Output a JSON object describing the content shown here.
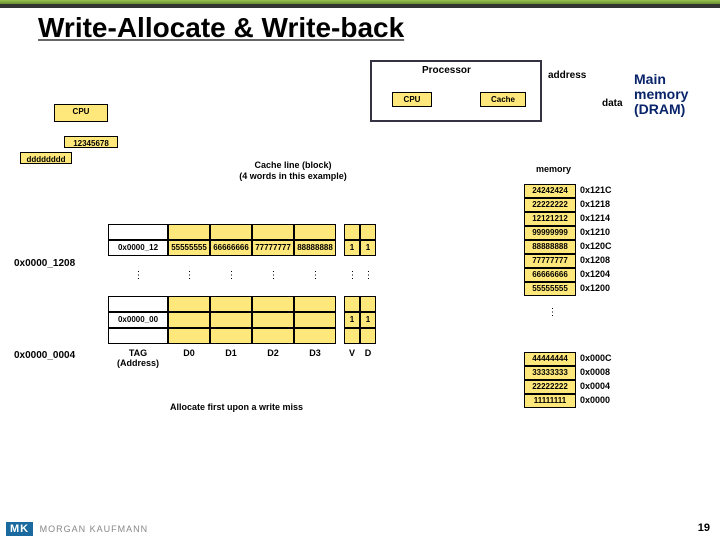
{
  "title": "Write-Allocate & Write-back",
  "processor": {
    "label": "Processor",
    "cpu": "CPU",
    "cache": "Cache"
  },
  "side": {
    "cpu": "CPU",
    "value": "12345678",
    "dddd": "dddddddd"
  },
  "cache_caption_l1": "Cache line (block)",
  "cache_caption_l2": "(4 words in this example)",
  "addr_labels": {
    "a1": "0x0000_1208",
    "a2": "0x0000_0004"
  },
  "tag_header": "TAG (Address)",
  "cols": {
    "d0": "D0",
    "d1": "D1",
    "d2": "D2",
    "d3": "D3",
    "v": "V",
    "d": "D"
  },
  "cache_rows": {
    "r1": {
      "tag": "0x0000_12",
      "d0": "55555555",
      "d1": "66666666",
      "d2": "77777777",
      "d3": "88888888",
      "v": "1",
      "d": "1"
    },
    "r2": {
      "tag": "0x0000_00",
      "d0": "",
      "d1": "",
      "d2": "",
      "d3": "",
      "v": "1",
      "d": "1"
    }
  },
  "alloc_note": "Allocate first upon a write miss",
  "mem_header": "memory",
  "mem_top": [
    {
      "val": "24242424",
      "addr": "0x121C"
    },
    {
      "val": "22222222",
      "addr": "0x1218"
    },
    {
      "val": "12121212",
      "addr": "0x1214"
    },
    {
      "val": "99999999",
      "addr": "0x1210"
    },
    {
      "val": "88888888",
      "addr": "0x120C"
    },
    {
      "val": "77777777",
      "addr": "0x1208"
    },
    {
      "val": "66666666",
      "addr": "0x1204"
    },
    {
      "val": "55555555",
      "addr": "0x1200"
    }
  ],
  "mem_bot": [
    {
      "val": "44444444",
      "addr": "0x000C"
    },
    {
      "val": "33333333",
      "addr": "0x0008"
    },
    {
      "val": "22222222",
      "addr": "0x0004"
    },
    {
      "val": "11111111",
      "addr": "0x0000"
    }
  ],
  "labels": {
    "address": "address",
    "data": "data"
  },
  "main_memory": {
    "l1": "Main",
    "l2": "memory",
    "l3": "(DRAM)"
  },
  "page": "19",
  "logo": "MORGAN KAUFMANN",
  "mk": "MK"
}
